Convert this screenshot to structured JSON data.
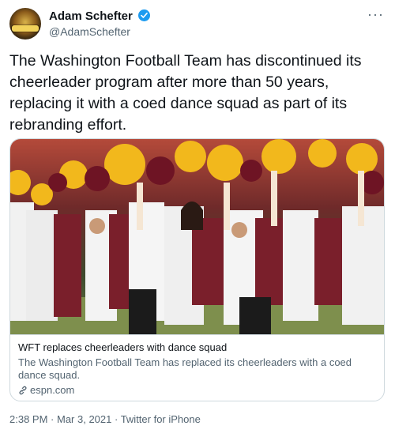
{
  "author": {
    "display_name": "Adam Schefter",
    "handle": "@AdamSchefter",
    "verified": true
  },
  "more_menu": "···",
  "tweet_text": "The Washington Football Team has discontinued its cheerleader program after more than 50 years, replacing it with a coed dance squad as part of its rebranding effort.",
  "card": {
    "title": "WFT replaces cheerleaders with dance squad",
    "description": "The Washington Football Team has replaced its cheerleaders with a coed dance squad.",
    "domain": "espn.com"
  },
  "meta": {
    "time": "2:38 PM",
    "separator": " · ",
    "date": "Mar 3, 2021",
    "source": "Twitter for iPhone"
  },
  "colors": {
    "text": "#0f1419",
    "secondary": "#536471",
    "verified": "#1d9bf0",
    "border": "#cfd9de",
    "uniform_burgundy": "#7a1f2b",
    "pompom_gold": "#f2b81c"
  },
  "icons": [
    "verified-badge-icon",
    "more-options-icon",
    "link-icon"
  ]
}
